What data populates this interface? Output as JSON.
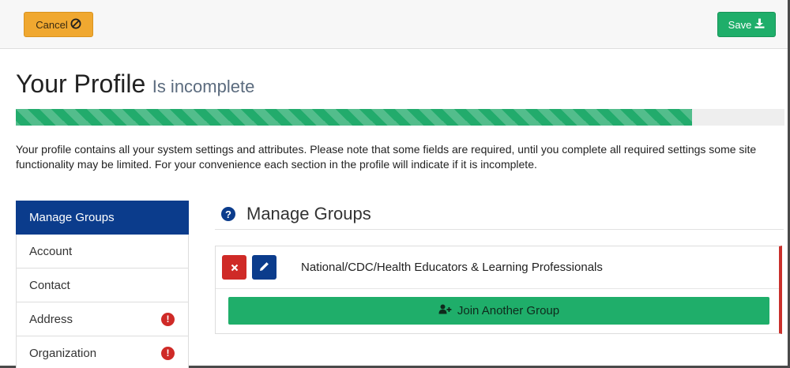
{
  "toolbar": {
    "cancel_label": "Cancel",
    "save_label": "Save"
  },
  "header": {
    "title": "Your Profile",
    "status": "Is incomplete"
  },
  "progress": {
    "fraction": 0.88
  },
  "intro_text": "Your profile contains all your system settings and attributes. Please note that some fields are required, until you complete all required settings some site functionality may be limited. For your convenience each section in the profile will indicate if it is incomplete.",
  "sidebar": {
    "items": [
      {
        "label": "Manage Groups",
        "active": true,
        "incomplete": false
      },
      {
        "label": "Account",
        "active": false,
        "incomplete": false
      },
      {
        "label": "Contact",
        "active": false,
        "incomplete": false
      },
      {
        "label": "Address",
        "active": false,
        "incomplete": true
      },
      {
        "label": "Organization",
        "active": false,
        "incomplete": true
      }
    ]
  },
  "main": {
    "section_title": "Manage Groups",
    "groups": [
      {
        "name": "National/CDC/Health Educators & Learning Professionals"
      }
    ],
    "join_label": "Join Another Group"
  },
  "colors": {
    "cancel": "#f0a830",
    "save": "#1fae6a",
    "active_nav": "#0b3c8c",
    "alert": "#cf2a27",
    "progress": "#22ab6c"
  },
  "icons": {
    "cancel": "ban-icon",
    "save": "download-icon",
    "help": "question-circle-icon",
    "delete": "times-icon",
    "edit": "pencil-icon",
    "join": "user-plus-icon",
    "alert": "exclamation-circle-icon"
  }
}
